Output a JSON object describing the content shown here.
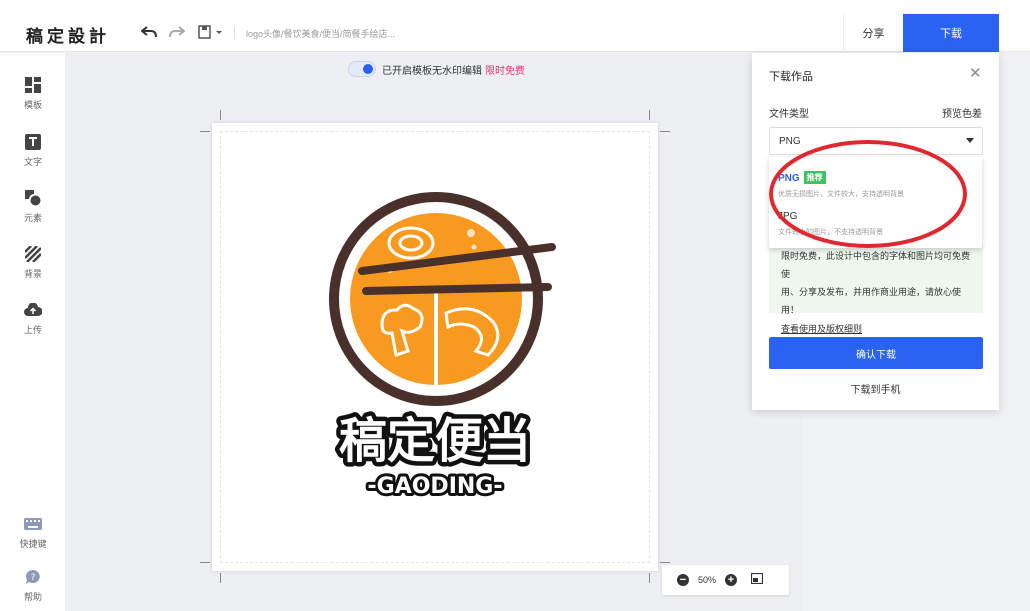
{
  "header": {
    "logo": "稿定設計",
    "breadcrumb": "logo头像/餐饮美食/便当/简餐手绘店...",
    "share_label": "分享",
    "download_label": "下载"
  },
  "sidebar": {
    "items": [
      {
        "label": "模板",
        "icon": "template-icon"
      },
      {
        "label": "文字",
        "icon": "text-icon"
      },
      {
        "label": "元素",
        "icon": "element-icon"
      },
      {
        "label": "背景",
        "icon": "background-icon"
      },
      {
        "label": "上传",
        "icon": "upload-icon"
      }
    ],
    "bottom": [
      {
        "label": "快捷键",
        "icon": "keyboard-icon"
      },
      {
        "label": "帮助",
        "icon": "help-icon"
      }
    ]
  },
  "canvas": {
    "toggle_text": "已开启模板无水印编辑",
    "toggle_free": "限时免费",
    "logo_title": "稿定便当",
    "logo_sub": "-GAODING-",
    "zoom": "50%"
  },
  "panel": {
    "title": "下载作品",
    "file_type_label": "文件类型",
    "preview_label": "预览色差",
    "selected": "PNG",
    "options": [
      {
        "name": "PNG",
        "badge": "推荐",
        "desc": "优质无损图片，文件较大，支持透明背景"
      },
      {
        "name": "JPG",
        "badge": "",
        "desc": "文件较小的图片，不支持透明背景"
      }
    ],
    "notice_line1": "限时免费，此设计中包含的字体和图片均可免费使",
    "notice_line2": "用、分享及发布，并用作商业用途，请放心使用！",
    "notice_link": "查看使用及版权细则",
    "confirm_label": "确认下载",
    "phone_label": "下载到手机"
  },
  "colors": {
    "accent": "#2a63f2",
    "badge": "#3ec35f",
    "free": "#f0306b",
    "logo_orange": "#f89a1f",
    "logo_brown": "#4a302a",
    "annotation": "#e0292f"
  }
}
